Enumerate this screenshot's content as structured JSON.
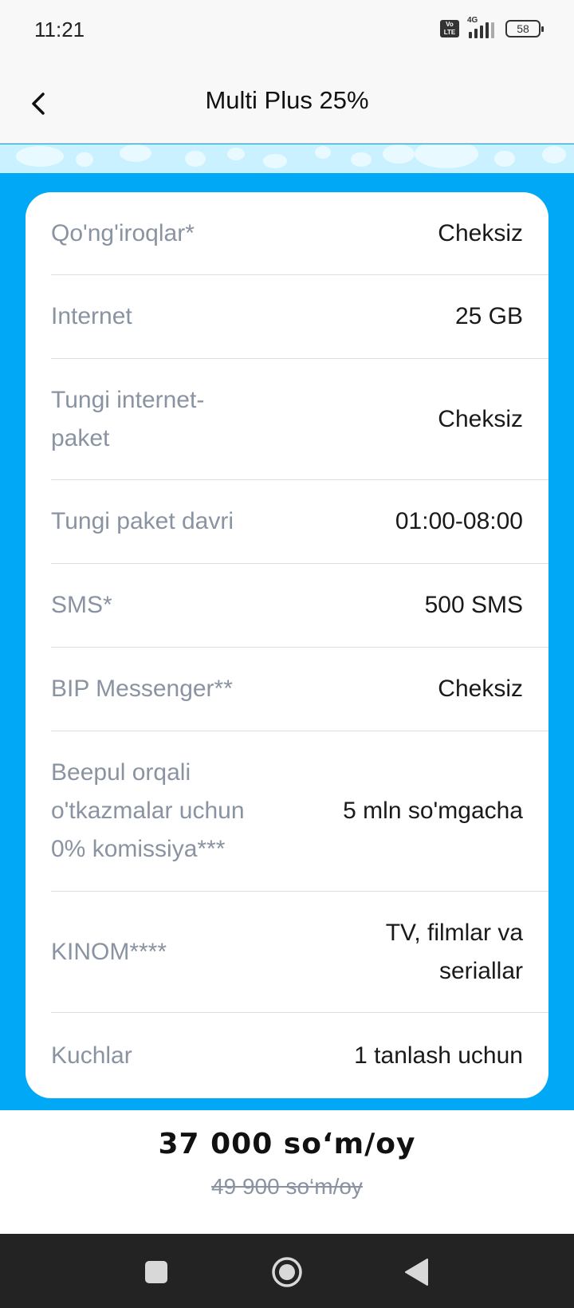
{
  "status": {
    "time": "11:21",
    "network": "4G",
    "volte": "Vo LTE",
    "battery": "58"
  },
  "header": {
    "title": "Multi Plus 25%"
  },
  "rows": [
    {
      "label": "Qo'ng'iroqlar*",
      "value": "Cheksiz"
    },
    {
      "label": "Internet",
      "value": "25 GB"
    },
    {
      "label": "Tungi internet-paket",
      "value": "Cheksiz"
    },
    {
      "label": "Tungi paket davri",
      "value": "01:00-08:00"
    },
    {
      "label": "SMS*",
      "value": "500 SMS"
    },
    {
      "label": "BIP Messenger**",
      "value": "Cheksiz"
    },
    {
      "label": "Beepul orqali o'tkazmalar uchun 0% komissiya***",
      "value": "5 mln so'mgacha"
    },
    {
      "label": "KINOM****",
      "value": "TV, filmlar va seriallar"
    },
    {
      "label": "Kuchlar",
      "value": "1 tanlash uchun"
    }
  ],
  "price": {
    "current": "37 000  so‘m/oy",
    "old": "49 900  so‘m/oy"
  },
  "nav": {
    "recents": "square-icon",
    "home": "circle-icon",
    "back": "triangle-back-icon"
  }
}
